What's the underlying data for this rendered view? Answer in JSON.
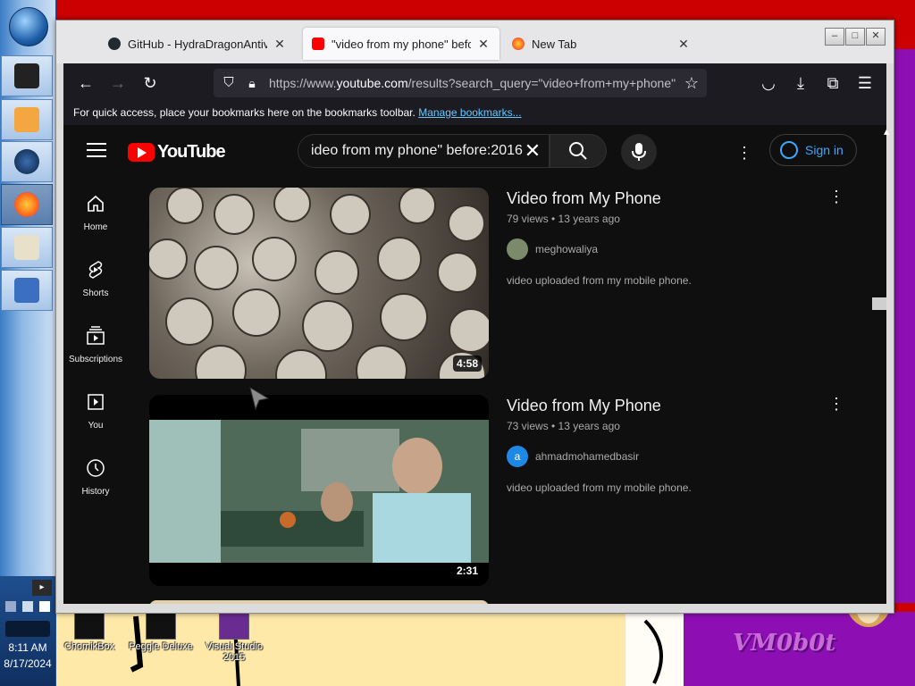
{
  "desktop": {
    "icons": [
      {
        "label": "ChomikBox"
      },
      {
        "label": "Peggle Deluxe"
      },
      {
        "label": "Visual Studio 2015"
      }
    ],
    "watermark": "VM0b0t"
  },
  "taskbar": {
    "clock_time": "8:11 AM",
    "clock_date": "8/17/2024",
    "tray_arrow": "▸",
    "pinned": [
      {
        "name": "terminal-app"
      },
      {
        "name": "media-player"
      },
      {
        "name": "globe-app"
      },
      {
        "name": "firefox",
        "active": true
      },
      {
        "name": "paint"
      },
      {
        "name": "remote-desktop"
      }
    ]
  },
  "browser": {
    "tabs": [
      {
        "title": "GitHub - HydraDragonAntivirus",
        "favicon": "github-icon",
        "active": false
      },
      {
        "title": "\"video from my phone\" before:2016",
        "favicon": "youtube-icon",
        "active": true
      },
      {
        "title": "New Tab",
        "favicon": "firefox-icon",
        "active": false
      }
    ],
    "url_prefix": "https://www.",
    "url_domain": "youtube.com",
    "url_rest": "/results?search_query=\"video+from+my+phone\"+before%3A2016",
    "bookmarks_text": "For quick access, place your bookmarks here on the bookmarks toolbar.",
    "bookmarks_link": "Manage bookmarks...",
    "close_glyph": "✕"
  },
  "youtube": {
    "logo_text": "YouTube",
    "search_query": "ideo from my phone\" before:2016",
    "search_clear": "✕",
    "more": "⋮",
    "signin": "Sign in",
    "sidebar": [
      {
        "label": "Home",
        "icon": "home-icon"
      },
      {
        "label": "Shorts",
        "icon": "shorts-icon"
      },
      {
        "label": "Subscriptions",
        "icon": "subscriptions-icon"
      },
      {
        "label": "You",
        "icon": "you-icon"
      },
      {
        "label": "History",
        "icon": "history-icon"
      }
    ],
    "videos": [
      {
        "title": "Video from My Phone",
        "meta": "79 views • 13 years ago",
        "channel": "meghowaliya",
        "avatar_letter": "",
        "description": "video uploaded from my mobile phone.",
        "duration": "4:58"
      },
      {
        "title": "Video from My Phone",
        "meta": "73 views • 13 years ago",
        "channel": "ahmadmohamedbasir",
        "avatar_letter": "a",
        "description": "video uploaded from my mobile phone.",
        "duration": "2:31"
      }
    ]
  },
  "colors": {
    "youtube_red": "#ff0000",
    "link_blue": "#3ea6ff",
    "page_bg": "#0f0f0f"
  }
}
